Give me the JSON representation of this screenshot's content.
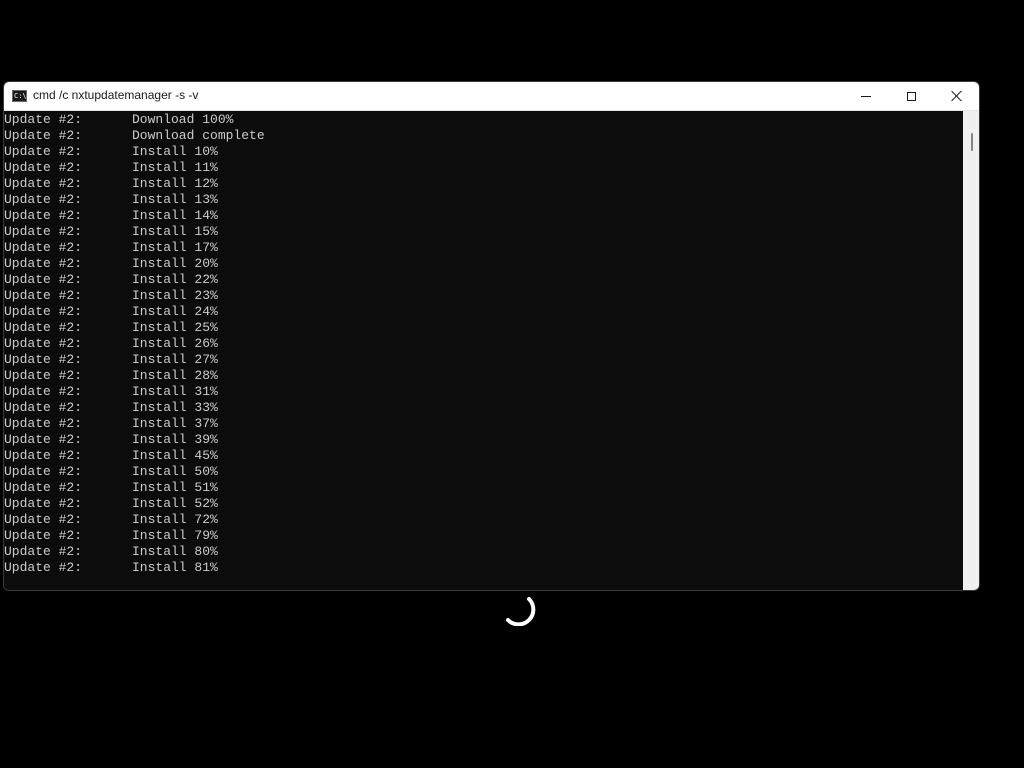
{
  "window": {
    "title": "cmd /c nxtupdatemanager -s -v",
    "icon": "cmd-icon",
    "icon_text": "C:\\"
  },
  "console": {
    "lines": [
      {
        "prefix": "Update #2:",
        "msg": "Download 100%"
      },
      {
        "prefix": "Update #2:",
        "msg": "Download complete"
      },
      {
        "prefix": "Update #2:",
        "msg": "Install 10%"
      },
      {
        "prefix": "Update #2:",
        "msg": "Install 11%"
      },
      {
        "prefix": "Update #2:",
        "msg": "Install 12%"
      },
      {
        "prefix": "Update #2:",
        "msg": "Install 13%"
      },
      {
        "prefix": "Update #2:",
        "msg": "Install 14%"
      },
      {
        "prefix": "Update #2:",
        "msg": "Install 15%"
      },
      {
        "prefix": "Update #2:",
        "msg": "Install 17%"
      },
      {
        "prefix": "Update #2:",
        "msg": "Install 20%"
      },
      {
        "prefix": "Update #2:",
        "msg": "Install 22%"
      },
      {
        "prefix": "Update #2:",
        "msg": "Install 23%"
      },
      {
        "prefix": "Update #2:",
        "msg": "Install 24%"
      },
      {
        "prefix": "Update #2:",
        "msg": "Install 25%"
      },
      {
        "prefix": "Update #2:",
        "msg": "Install 26%"
      },
      {
        "prefix": "Update #2:",
        "msg": "Install 27%"
      },
      {
        "prefix": "Update #2:",
        "msg": "Install 28%"
      },
      {
        "prefix": "Update #2:",
        "msg": "Install 31%"
      },
      {
        "prefix": "Update #2:",
        "msg": "Install 33%"
      },
      {
        "prefix": "Update #2:",
        "msg": "Install 37%"
      },
      {
        "prefix": "Update #2:",
        "msg": "Install 39%"
      },
      {
        "prefix": "Update #2:",
        "msg": "Install 45%"
      },
      {
        "prefix": "Update #2:",
        "msg": "Install 50%"
      },
      {
        "prefix": "Update #2:",
        "msg": "Install 51%"
      },
      {
        "prefix": "Update #2:",
        "msg": "Install 52%"
      },
      {
        "prefix": "Update #2:",
        "msg": "Install 72%"
      },
      {
        "prefix": "Update #2:",
        "msg": "Install 79%"
      },
      {
        "prefix": "Update #2:",
        "msg": "Install 80%"
      },
      {
        "prefix": "Update #2:",
        "msg": "Install 81%"
      }
    ]
  },
  "colors": {
    "console_bg": "#0c0c0c",
    "console_text": "#cccccc",
    "titlebar_bg": "#ffffff",
    "spinner": "#ffffff"
  },
  "icons": {
    "minimize": "minimize-icon",
    "maximize": "maximize-icon",
    "close": "close-icon",
    "spinner": "loading-spinner-icon"
  }
}
